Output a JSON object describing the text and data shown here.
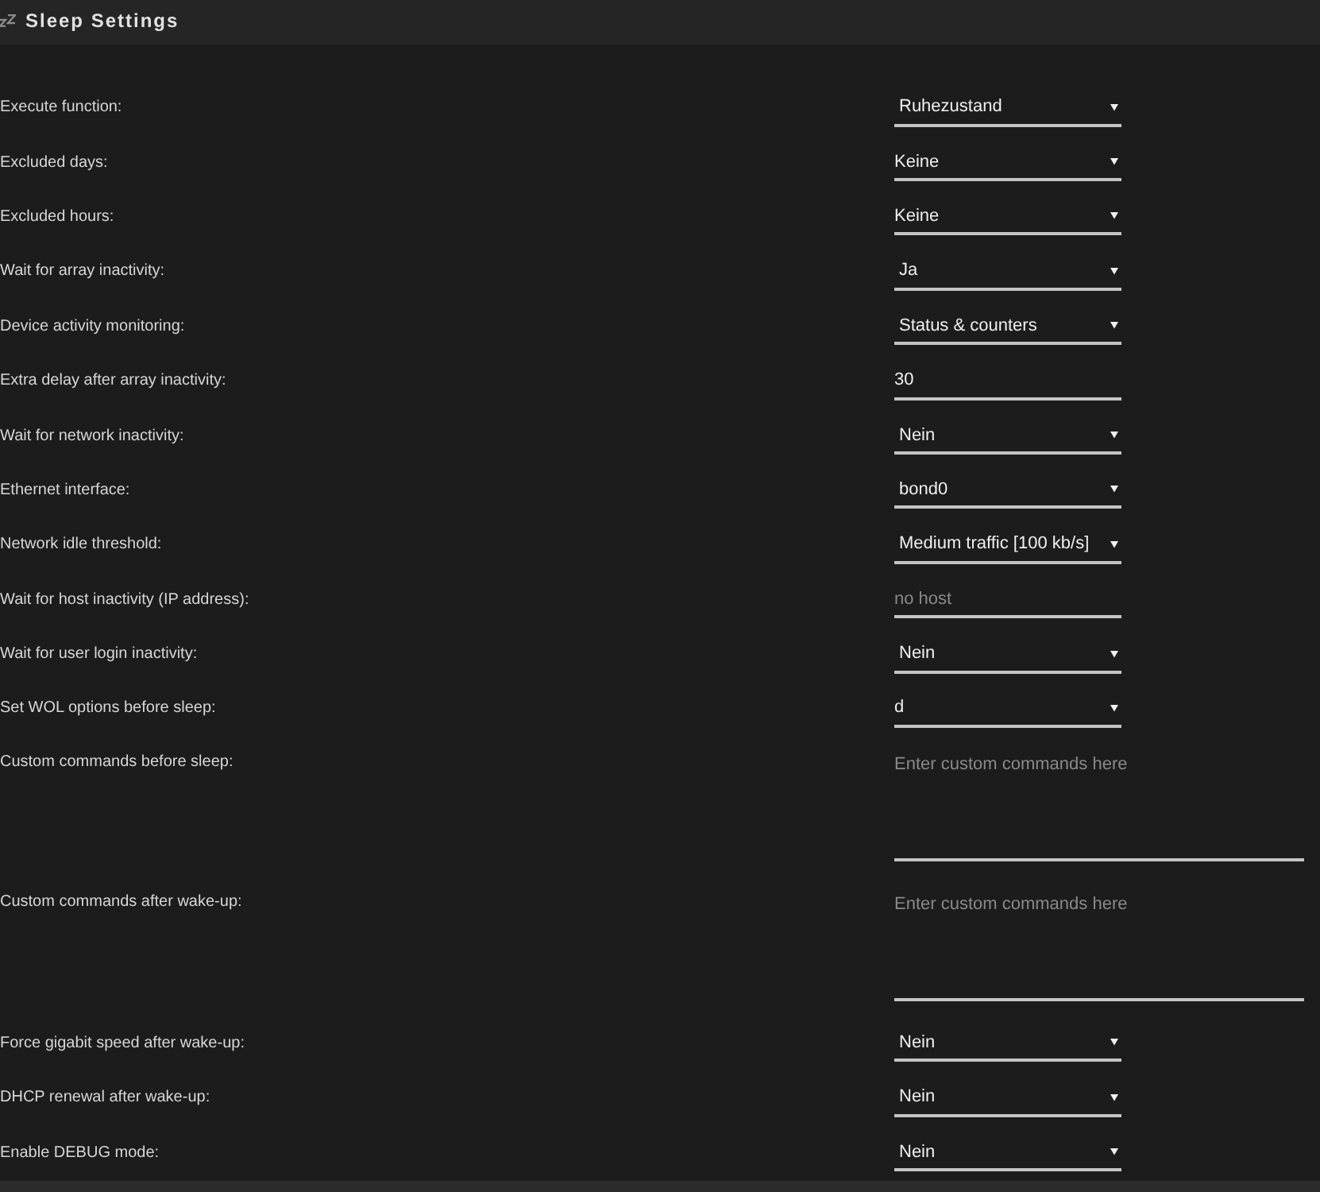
{
  "header": {
    "title": "Sleep Settings"
  },
  "settings": [
    {
      "label": "Execute function:",
      "kind": "select",
      "value": "Ruhezustand"
    },
    {
      "label": "Excluded days:",
      "kind": "checklist",
      "value": "Keine"
    },
    {
      "label": "Excluded hours:",
      "kind": "checklist",
      "value": "Keine"
    },
    {
      "label": "Wait for array inactivity:",
      "kind": "select",
      "value": "Ja"
    },
    {
      "label": "Device activity monitoring:",
      "kind": "select",
      "value": "Status & counters"
    },
    {
      "label": "Extra delay after array inactivity:",
      "kind": "input",
      "value": "30"
    },
    {
      "label": "Wait for network inactivity:",
      "kind": "select",
      "value": "Nein"
    },
    {
      "label": "Ethernet interface:",
      "kind": "select",
      "value": "bond0"
    },
    {
      "label": "Network idle threshold:",
      "kind": "select",
      "value": "Medium traffic [100 kb/s]"
    },
    {
      "label": "Wait for host inactivity (IP address):",
      "kind": "input",
      "placeholder": "no host"
    },
    {
      "label": "Wait for user login inactivity:",
      "kind": "select",
      "value": "Nein"
    },
    {
      "label": "Set WOL options before sleep:",
      "kind": "checklist",
      "value": "d"
    },
    {
      "label": "Custom commands before sleep:",
      "kind": "textarea",
      "placeholder": "Enter custom commands here"
    },
    {
      "label": "Custom commands after wake-up:",
      "kind": "textarea",
      "placeholder": "Enter custom commands here"
    },
    {
      "label": "Force gigabit speed after wake-up:",
      "kind": "select",
      "value": "Nein"
    },
    {
      "label": "DHCP renewal after wake-up:",
      "kind": "select",
      "value": "Nein"
    },
    {
      "label": "Enable DEBUG mode:",
      "kind": "select",
      "value": "Nein"
    }
  ]
}
